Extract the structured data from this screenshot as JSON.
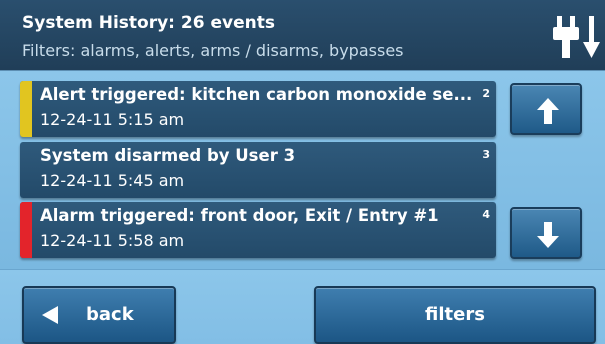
{
  "header": {
    "title": "System History: 26 events",
    "subtitle": "Filters: alarms, alerts, arms / disarms, bypasses",
    "icon": "power-plug-icon"
  },
  "events": [
    {
      "text": "Alert triggered: kitchen carbon monoxide se...",
      "time": "12-24-11 5:15 am",
      "number": "2",
      "stripe_color": "#e1c520"
    },
    {
      "text": "System disarmed by User 3",
      "time": "12-24-11 5:45 am",
      "number": "3",
      "stripe_color": ""
    },
    {
      "text": "Alarm triggered: front door, Exit / Entry #1",
      "time": "12-24-11 5:58 am",
      "number": "4",
      "stripe_color": "#e3242b"
    }
  ],
  "scroll": {
    "up_icon": "arrow-up-icon",
    "down_icon": "arrow-down-icon"
  },
  "footer": {
    "back_label": "back",
    "filters_label": "filters",
    "back_icon": "triangle-left-icon"
  },
  "colors": {
    "header_bg": "#203e58",
    "panel_bg": "#8cc6ea",
    "row_bg": "#2a5576",
    "button_bg": "#2a6898"
  }
}
